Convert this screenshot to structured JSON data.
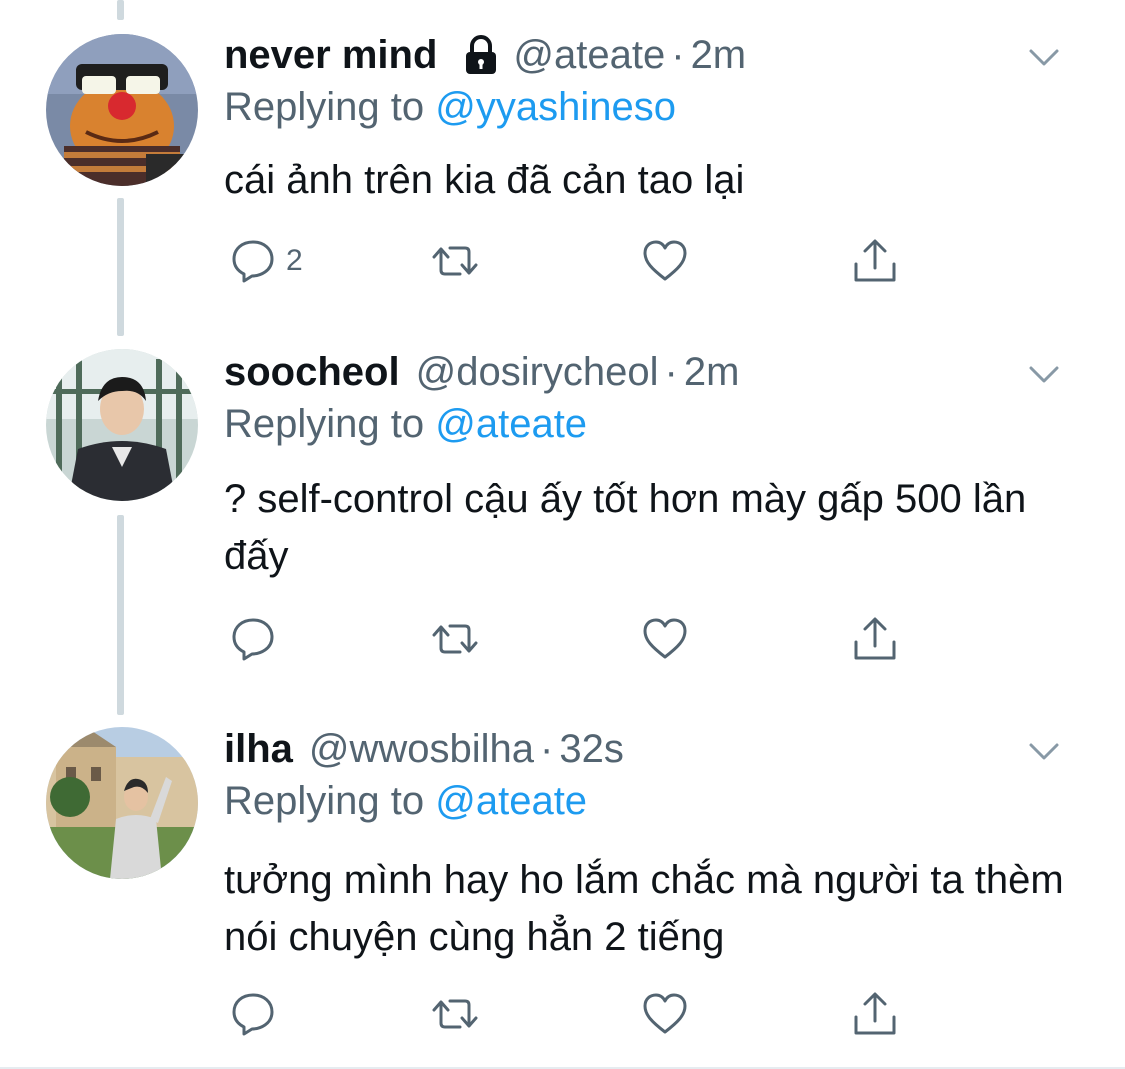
{
  "tweets": [
    {
      "name": "never mind",
      "protected": true,
      "handle": "@ateate",
      "dot": "·",
      "time": "2m",
      "replying_prefix": "Replying to ",
      "replying_to": "@yyashineso",
      "text": "cái ảnh trên kia đã cản tao lại",
      "reply_count": "2",
      "avatar_icon": "muppet-avatar"
    },
    {
      "name": "soocheol",
      "protected": false,
      "handle": "@dosirycheol",
      "dot": "·",
      "time": "2m",
      "replying_prefix": "Replying to ",
      "replying_to": "@ateate",
      "text": "? self-control cậu ấy tốt hơn mày gấp 500 lần đấy",
      "reply_count": "",
      "avatar_icon": "person-photo-avatar"
    },
    {
      "name": "ilha",
      "protected": false,
      "handle": "@wwosbilha",
      "dot": "·",
      "time": "32s",
      "replying_prefix": "Replying to ",
      "replying_to": "@ateate",
      "text": "tưởng mình hay ho lắm chắc mà người ta thèm nói chuyện cùng hẳn 2 tiếng",
      "reply_count": "",
      "avatar_icon": "person-photo-avatar"
    }
  ],
  "colors": {
    "text": "#0f1419",
    "secondary": "#536471",
    "mention": "#1d9bf0",
    "thread_line": "#cfd9de"
  }
}
